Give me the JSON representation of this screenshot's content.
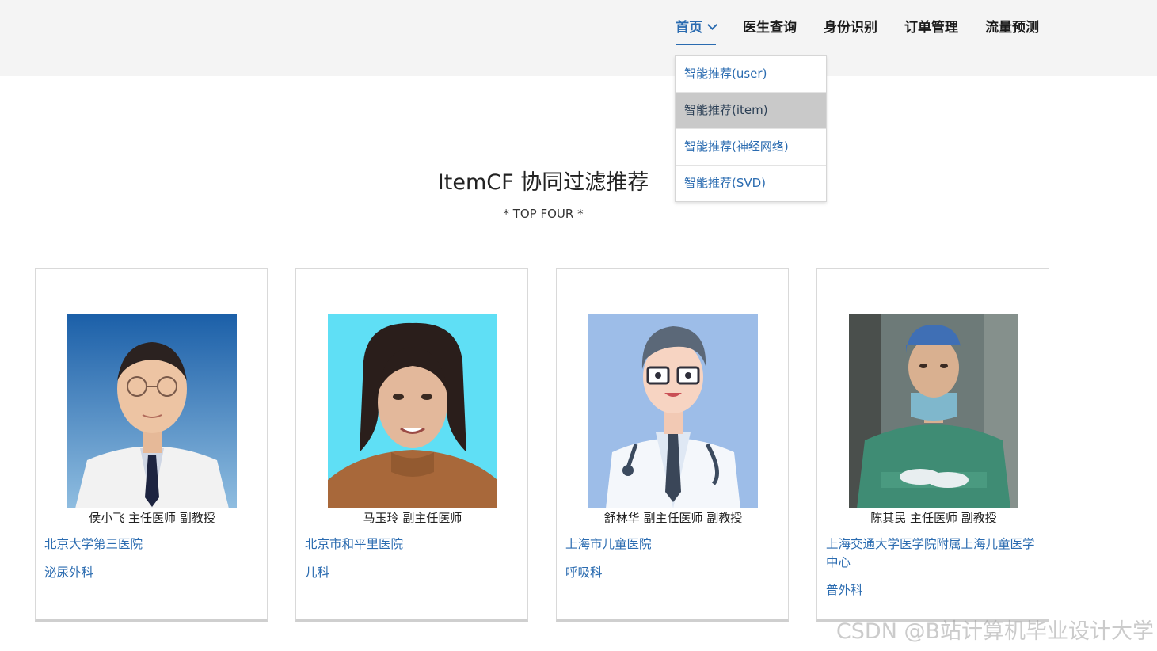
{
  "nav": {
    "items": [
      {
        "label": "首页"
      },
      {
        "label": "医生查询"
      },
      {
        "label": "身份识别"
      },
      {
        "label": "订单管理"
      },
      {
        "label": "流量预测"
      }
    ]
  },
  "dropdown": {
    "items": [
      {
        "label": "智能推荐(user)"
      },
      {
        "label": "智能推荐(item)"
      },
      {
        "label": "智能推荐(神经网络)"
      },
      {
        "label": "智能推荐(SVD)"
      }
    ]
  },
  "section": {
    "title": "ItemCF 协同过滤推荐",
    "subtitle": "* TOP FOUR *"
  },
  "doctors": [
    {
      "name": "侯小飞 主任医师  副教授",
      "hospital": "北京大学第三医院",
      "department": "泌尿外科"
    },
    {
      "name": "马玉玲 副主任医师",
      "hospital": "北京市和平里医院",
      "department": "儿科"
    },
    {
      "name": "舒林华 副主任医师  副教授",
      "hospital": "上海市儿童医院",
      "department": "呼吸科"
    },
    {
      "name": "陈其民 主任医师  副教授",
      "hospital": "上海交通大学医学院附属上海儿童医学中心",
      "department": "普外科"
    }
  ],
  "watermark": "CSDN @B站计算机毕业设计大学"
}
